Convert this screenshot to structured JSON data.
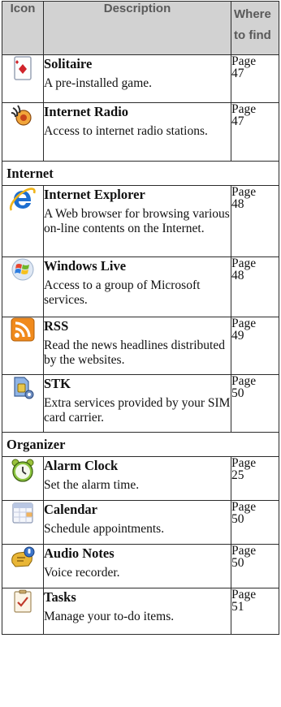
{
  "header": {
    "icon": "Icon",
    "description": "Description",
    "where_line1": "Where",
    "where_line2": "to find"
  },
  "rows": [
    {
      "icon": "solitaire-card-icon",
      "title": "Solitaire",
      "desc": "A pre-installed game.",
      "page_word": "Page",
      "page_num": "47"
    },
    {
      "icon": "internet-radio-icon",
      "title": "Internet Radio",
      "desc": "Access to internet radio stations.",
      "page_word": "Page",
      "page_num": "47"
    }
  ],
  "sections": [
    {
      "name": "Internet",
      "rows": [
        {
          "icon": "internet-explorer-icon",
          "title": "Internet Explorer",
          "desc": "A Web browser for browsing various on-line contents on the Internet.",
          "page_word": "Page",
          "page_num": "48"
        },
        {
          "icon": "windows-live-icon",
          "title": "Windows Live",
          "desc": "Access to a group of Microsoft services.",
          "page_word": "Page",
          "page_num": "48"
        },
        {
          "icon": "rss-icon",
          "title": "RSS",
          "desc": "Read the news headlines distributed by the websites.",
          "page_word": "Page",
          "page_num": "49"
        },
        {
          "icon": "sim-toolkit-icon",
          "title": "STK",
          "desc": "Extra services provided by your SIM card carrier.",
          "page_word": "Page",
          "page_num": "50"
        }
      ]
    },
    {
      "name": "Organizer",
      "rows": [
        {
          "icon": "alarm-clock-icon",
          "title": "Alarm Clock",
          "desc": "Set the alarm time.",
          "page_word": "Page",
          "page_num": "25"
        },
        {
          "icon": "calendar-icon",
          "title": "Calendar",
          "desc": "Schedule appointments.",
          "page_word": "Page",
          "page_num": "50"
        },
        {
          "icon": "audio-notes-icon",
          "title": "Audio Notes",
          "desc": "Voice recorder.",
          "page_word": "Page",
          "page_num": "50"
        },
        {
          "icon": "tasks-icon",
          "title": "Tasks",
          "desc": "Manage your to-do items.",
          "page_word": "Page",
          "page_num": "51"
        }
      ]
    }
  ],
  "colors": {
    "header_bg": "#d2d2d2",
    "header_text": "#5a5a5a",
    "border": "#2b2b2b",
    "rss_orange": "#f08a1c",
    "ie_blue": "#1e6fd0"
  }
}
